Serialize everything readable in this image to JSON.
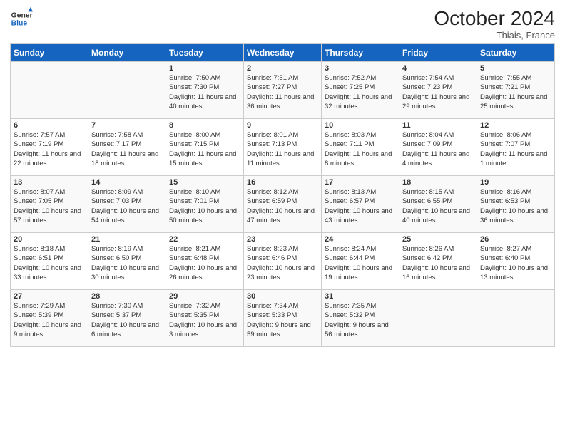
{
  "header": {
    "logo_general": "General",
    "logo_blue": "Blue",
    "month_title": "October 2024",
    "location": "Thiais, France"
  },
  "days_of_week": [
    "Sunday",
    "Monday",
    "Tuesday",
    "Wednesday",
    "Thursday",
    "Friday",
    "Saturday"
  ],
  "weeks": [
    [
      {
        "day": "",
        "info": ""
      },
      {
        "day": "",
        "info": ""
      },
      {
        "day": "1",
        "info": "Sunrise: 7:50 AM\nSunset: 7:30 PM\nDaylight: 11 hours and 40 minutes."
      },
      {
        "day": "2",
        "info": "Sunrise: 7:51 AM\nSunset: 7:27 PM\nDaylight: 11 hours and 36 minutes."
      },
      {
        "day": "3",
        "info": "Sunrise: 7:52 AM\nSunset: 7:25 PM\nDaylight: 11 hours and 32 minutes."
      },
      {
        "day": "4",
        "info": "Sunrise: 7:54 AM\nSunset: 7:23 PM\nDaylight: 11 hours and 29 minutes."
      },
      {
        "day": "5",
        "info": "Sunrise: 7:55 AM\nSunset: 7:21 PM\nDaylight: 11 hours and 25 minutes."
      }
    ],
    [
      {
        "day": "6",
        "info": "Sunrise: 7:57 AM\nSunset: 7:19 PM\nDaylight: 11 hours and 22 minutes."
      },
      {
        "day": "7",
        "info": "Sunrise: 7:58 AM\nSunset: 7:17 PM\nDaylight: 11 hours and 18 minutes."
      },
      {
        "day": "8",
        "info": "Sunrise: 8:00 AM\nSunset: 7:15 PM\nDaylight: 11 hours and 15 minutes."
      },
      {
        "day": "9",
        "info": "Sunrise: 8:01 AM\nSunset: 7:13 PM\nDaylight: 11 hours and 11 minutes."
      },
      {
        "day": "10",
        "info": "Sunrise: 8:03 AM\nSunset: 7:11 PM\nDaylight: 11 hours and 8 minutes."
      },
      {
        "day": "11",
        "info": "Sunrise: 8:04 AM\nSunset: 7:09 PM\nDaylight: 11 hours and 4 minutes."
      },
      {
        "day": "12",
        "info": "Sunrise: 8:06 AM\nSunset: 7:07 PM\nDaylight: 11 hours and 1 minute."
      }
    ],
    [
      {
        "day": "13",
        "info": "Sunrise: 8:07 AM\nSunset: 7:05 PM\nDaylight: 10 hours and 57 minutes."
      },
      {
        "day": "14",
        "info": "Sunrise: 8:09 AM\nSunset: 7:03 PM\nDaylight: 10 hours and 54 minutes."
      },
      {
        "day": "15",
        "info": "Sunrise: 8:10 AM\nSunset: 7:01 PM\nDaylight: 10 hours and 50 minutes."
      },
      {
        "day": "16",
        "info": "Sunrise: 8:12 AM\nSunset: 6:59 PM\nDaylight: 10 hours and 47 minutes."
      },
      {
        "day": "17",
        "info": "Sunrise: 8:13 AM\nSunset: 6:57 PM\nDaylight: 10 hours and 43 minutes."
      },
      {
        "day": "18",
        "info": "Sunrise: 8:15 AM\nSunset: 6:55 PM\nDaylight: 10 hours and 40 minutes."
      },
      {
        "day": "19",
        "info": "Sunrise: 8:16 AM\nSunset: 6:53 PM\nDaylight: 10 hours and 36 minutes."
      }
    ],
    [
      {
        "day": "20",
        "info": "Sunrise: 8:18 AM\nSunset: 6:51 PM\nDaylight: 10 hours and 33 minutes."
      },
      {
        "day": "21",
        "info": "Sunrise: 8:19 AM\nSunset: 6:50 PM\nDaylight: 10 hours and 30 minutes."
      },
      {
        "day": "22",
        "info": "Sunrise: 8:21 AM\nSunset: 6:48 PM\nDaylight: 10 hours and 26 minutes."
      },
      {
        "day": "23",
        "info": "Sunrise: 8:23 AM\nSunset: 6:46 PM\nDaylight: 10 hours and 23 minutes."
      },
      {
        "day": "24",
        "info": "Sunrise: 8:24 AM\nSunset: 6:44 PM\nDaylight: 10 hours and 19 minutes."
      },
      {
        "day": "25",
        "info": "Sunrise: 8:26 AM\nSunset: 6:42 PM\nDaylight: 10 hours and 16 minutes."
      },
      {
        "day": "26",
        "info": "Sunrise: 8:27 AM\nSunset: 6:40 PM\nDaylight: 10 hours and 13 minutes."
      }
    ],
    [
      {
        "day": "27",
        "info": "Sunrise: 7:29 AM\nSunset: 5:39 PM\nDaylight: 10 hours and 9 minutes."
      },
      {
        "day": "28",
        "info": "Sunrise: 7:30 AM\nSunset: 5:37 PM\nDaylight: 10 hours and 6 minutes."
      },
      {
        "day": "29",
        "info": "Sunrise: 7:32 AM\nSunset: 5:35 PM\nDaylight: 10 hours and 3 minutes."
      },
      {
        "day": "30",
        "info": "Sunrise: 7:34 AM\nSunset: 5:33 PM\nDaylight: 9 hours and 59 minutes."
      },
      {
        "day": "31",
        "info": "Sunrise: 7:35 AM\nSunset: 5:32 PM\nDaylight: 9 hours and 56 minutes."
      },
      {
        "day": "",
        "info": ""
      },
      {
        "day": "",
        "info": ""
      }
    ]
  ]
}
